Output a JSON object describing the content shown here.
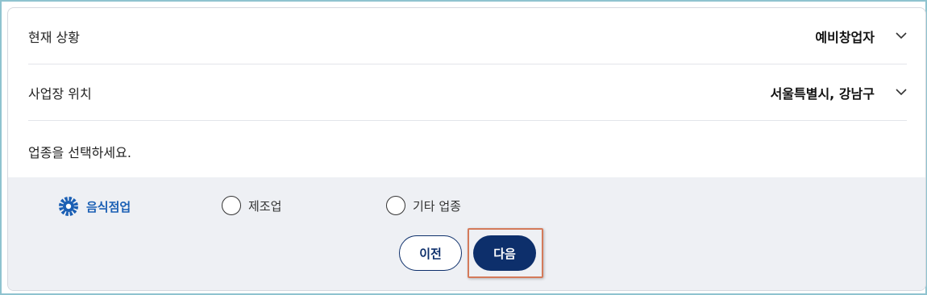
{
  "rows": [
    {
      "label": "현재 상황",
      "value": "예비창업자"
    },
    {
      "label": "사업장 위치",
      "value": "서울특별시, 강남구"
    }
  ],
  "industry_prompt": "업종을 선택하세요.",
  "industry_options": [
    {
      "label": "음식점업",
      "selected": true
    },
    {
      "label": "제조업",
      "selected": false
    },
    {
      "label": "기타 업종",
      "selected": false
    }
  ],
  "buttons": {
    "prev": "이전",
    "next": "다음"
  },
  "colors": {
    "primary": "#0d2f6b",
    "selected_option": "#1a5fb4",
    "panel_bg": "#eef0f4",
    "highlight_border": "#d47a5a"
  },
  "icons": {
    "dropdown": "chevron-down-icon",
    "selected": "radio-selected-icon"
  }
}
